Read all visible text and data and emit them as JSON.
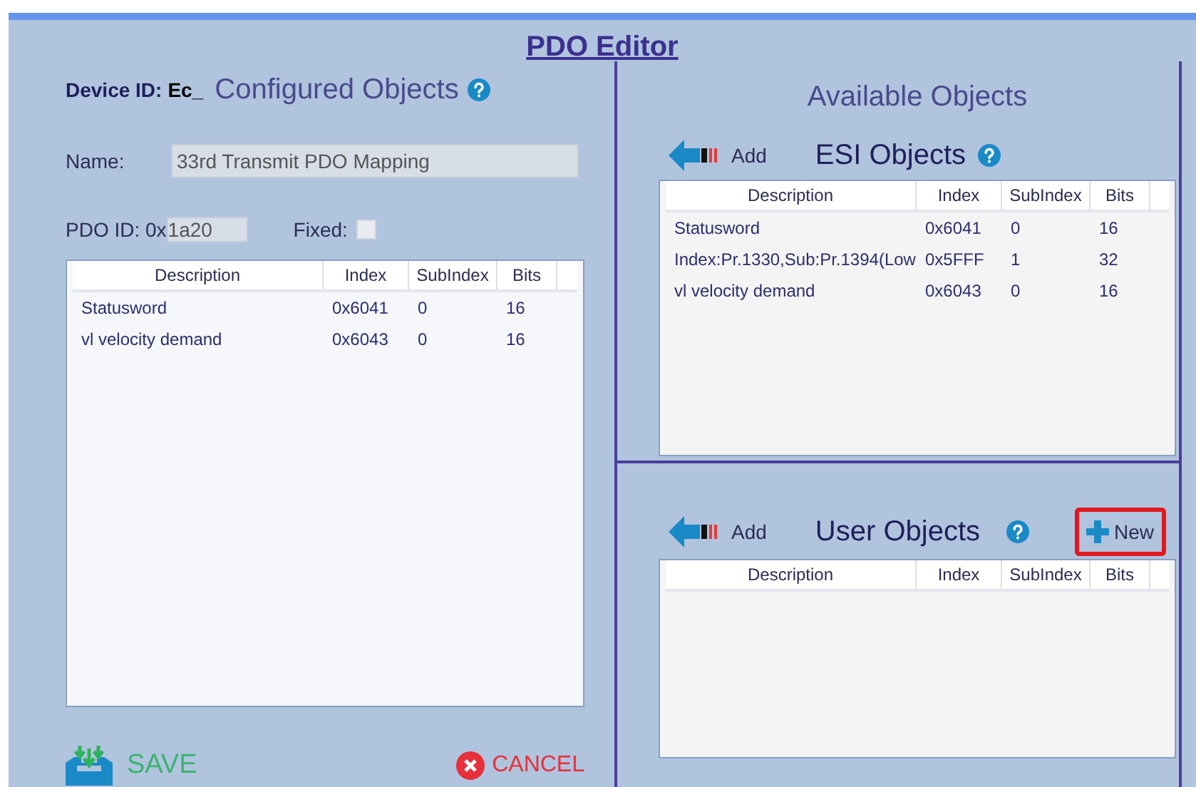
{
  "title": "PDO Editor",
  "configured": {
    "device_label": "Device ID:",
    "device_id": "Ec_",
    "heading": "Configured Objects",
    "name_label": "Name:",
    "name_value": "33rd Transmit PDO Mapping",
    "pdo_label": "PDO ID: 0x",
    "pdo_value": "1a20",
    "fixed_label": "Fixed:",
    "fixed_checked": false,
    "table": {
      "columns": [
        "Description",
        "Index",
        "SubIndex",
        "Bits"
      ],
      "rows": [
        [
          "Statusword",
          "0x6041",
          "0",
          "16"
        ],
        [
          "vl velocity demand",
          "0x6043",
          "0",
          "16"
        ]
      ]
    },
    "save": "SAVE",
    "cancel": "CANCEL"
  },
  "available": {
    "heading": "Available Objects",
    "esi": {
      "add": "Add",
      "heading": "ESI Objects",
      "table": {
        "columns": [
          "Description",
          "Index",
          "SubIndex",
          "Bits"
        ],
        "rows": [
          [
            "Statusword",
            "0x6041",
            "0",
            "16"
          ],
          [
            "Index:Pr.1330,Sub:Pr.1394(Low",
            "0x5FFF",
            "1",
            "32"
          ],
          [
            "vl velocity demand",
            "0x6043",
            "0",
            "16"
          ]
        ]
      }
    },
    "user": {
      "add": "Add",
      "heading": "User Objects",
      "new_button": {
        "label": "New",
        "highlighted": true
      },
      "table": {
        "columns": [
          "Description",
          "Index",
          "SubIndex",
          "Bits"
        ]
      }
    }
  }
}
